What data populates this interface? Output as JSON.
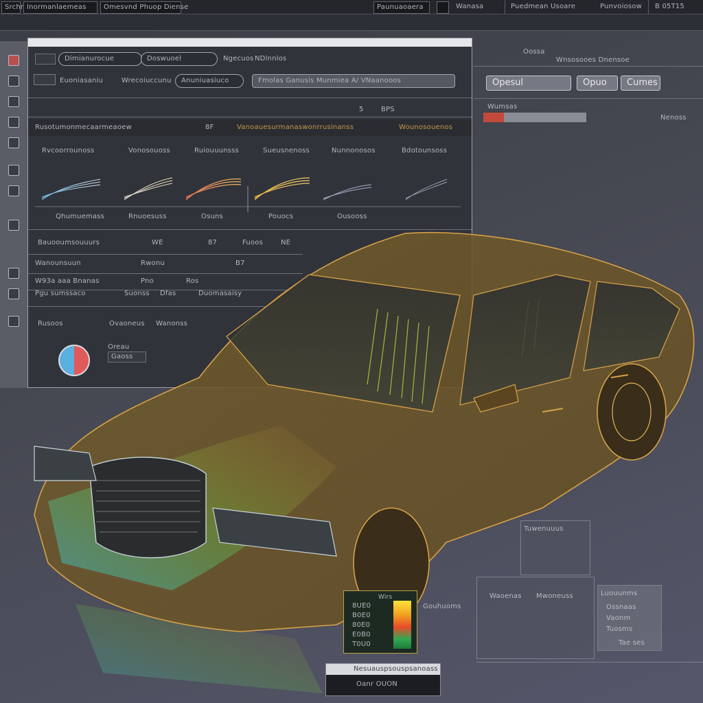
{
  "topbar": {
    "menu1": "Srchr",
    "menu2": "Inormanlaemeas",
    "menu3": "Omesvnd Phuop Diense",
    "menu4": "Paunuaoaera",
    "menu5": "Wanasa",
    "menu6": "Puedmean Usoare",
    "menu7": "Punvoiosow",
    "menu8": "B 05T15"
  },
  "main_panel": {
    "tab1": "Dimianurocue",
    "tab2": "Doswuoel",
    "tab3": "Ngecuos",
    "tab4": "NDlnnlos",
    "field1": "Euoniasaniu",
    "field2": "Wrecoiuccunu",
    "pill1": "Anuniuasiuco",
    "pill2": "Fmolas Ganusis Munmiea A/ VNaanooos",
    "counter1": "5",
    "counter2": "BPS",
    "header_row_left": "Rusotumonmecaarmeaoew",
    "header_row_mid": "8F",
    "header_row_right": "Vanoauesurmanaswonrrusinanss",
    "header_row_far": "Wounosouenos",
    "chart_titles": [
      "Rvcoorrounoss",
      "Vonosouoss",
      "Ruiouuunsss",
      "Sueusnenoss",
      "Nunnonosos",
      "Bdotounsoss"
    ],
    "chart_captions": [
      "Qhumuemass",
      "Rnuoesuss",
      "Osuns",
      "Pouocs",
      "Ousooss"
    ],
    "table_rows": [
      {
        "label": "Bauooumsouuurs",
        "v1": "WE",
        "v2": "87",
        "v3": "Fuoos",
        "v4": "NE"
      },
      {
        "label": "Wanounsuun",
        "v1": "Rwonu",
        "v2": "B7",
        "v3": "",
        "v4": ""
      },
      {
        "label": "W93a aaa Bnanas",
        "v1": "Pno",
        "v2": "Ros",
        "v3": "",
        "v4": ""
      },
      {
        "label": "Pgu sumssaco",
        "v1": "Suonss",
        "v2": "Dfas",
        "v3": "Duomasaisy",
        "v4": ""
      }
    ],
    "footer_labels": [
      "Rusoos",
      "Ovaoneus",
      "Wanonss"
    ],
    "badge_label": "Oreau",
    "badge_value": "Gaoss"
  },
  "right_panel": {
    "label1": "Oossa",
    "label2": "Wnsosooes Dnensoe",
    "btn1": "Opesul",
    "btn2": "Opuo",
    "btn3": "Cumes",
    "status_label": "Wumsas",
    "status_right": "Nenoss"
  },
  "legend": {
    "rows": [
      "8UE0",
      "B0E0",
      "80E0",
      "E0B0",
      "T0U0"
    ],
    "title": "Wirs",
    "side_label": "Gouhuoms"
  },
  "bottom_box": {
    "title": "Nesuauspsouspsanoass",
    "value": "Oanr OUON"
  },
  "right_cards": {
    "card1_title": "Tuwenuuus",
    "card2_left": "Waoenas",
    "card2_mid": "Mwoneuss",
    "card3_title": "Luouunms",
    "card3_rows": [
      "Ossnaas",
      "Vaonm",
      "Tuosms",
      "Tae ses"
    ]
  }
}
